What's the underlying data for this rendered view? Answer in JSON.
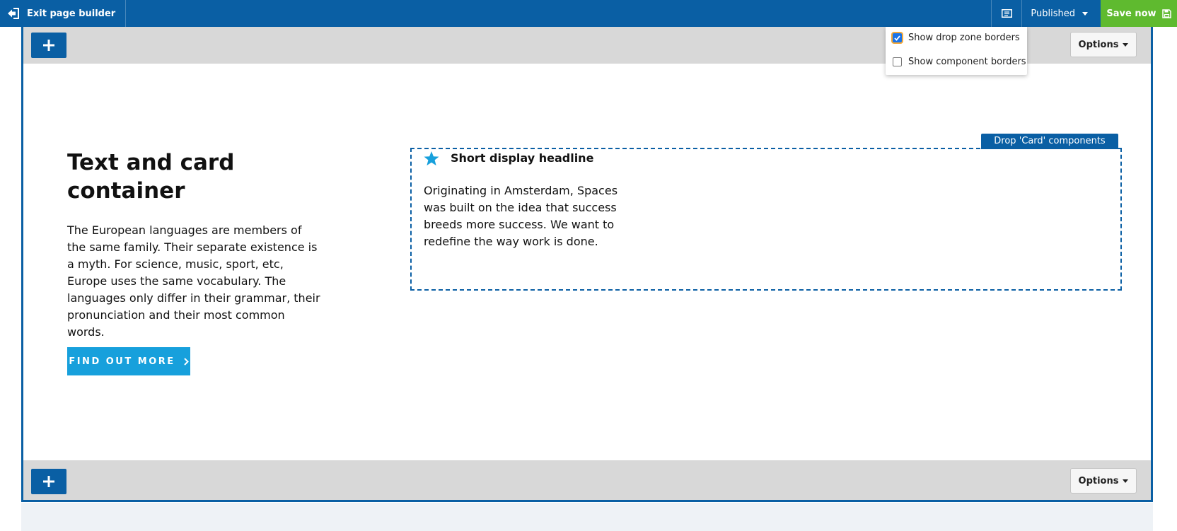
{
  "toolbar": {
    "exit_label": "Exit page builder",
    "status_label": "Published",
    "save_label": "Save now"
  },
  "view_menu": {
    "options": [
      {
        "label": "Show drop zone borders",
        "checked": true
      },
      {
        "label": "Show component borders",
        "checked": false
      }
    ]
  },
  "section": {
    "options_label": "Options",
    "heading": "Text and card container",
    "body": "The European languages are members of the same family. Their separate existence is a myth. For science, music, sport, etc, Europe uses the same vocabulary. The languages only differ in their grammar, their pronunciation and their most common words.",
    "cta_label": "FIND OUT MORE"
  },
  "dropzone": {
    "label": "Drop 'Card' components here."
  },
  "card": {
    "icon": "star-icon",
    "title": "Short display headline",
    "text": "Originating in Amsterdam, Spaces was built on the idea that success breeds more success. We want to redefine the way work is done."
  },
  "colors": {
    "toolbar_blue": "#0a5fa4",
    "save_green": "#5fba2f",
    "cta_blue": "#17a0dc",
    "bar_gray": "#d8d8d8"
  }
}
